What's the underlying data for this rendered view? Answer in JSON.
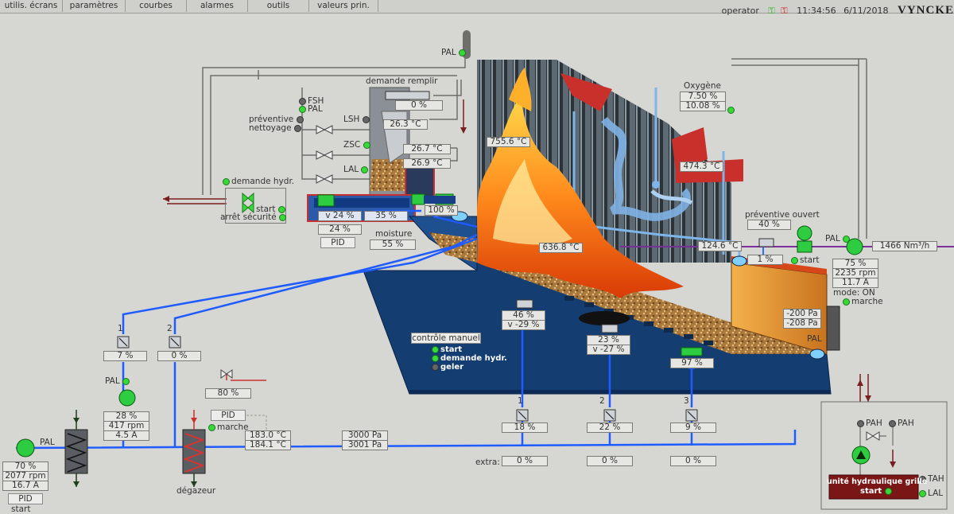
{
  "menu": {
    "tabs": [
      "utilis. écrans",
      "paramètres",
      "courbes",
      "alarmes",
      "outils",
      "valeurs prin."
    ]
  },
  "status": {
    "user": "operator",
    "time": "11:34:56",
    "date": "6/11/2018",
    "brand": "VYNCKE"
  },
  "top_labels": {
    "pal_top": "PAL",
    "demande_remplir": "demande remplir",
    "pct_remplir": "0 %",
    "fsh": "FSH",
    "pal_left": "PAL",
    "preventive": "préventive",
    "nettoyage": "nettoyage",
    "lsh": "LSH",
    "zsc": "ZSC",
    "lal": "LAL",
    "t1": "26.3 °C",
    "t2": "26.7 °C",
    "t3": "26.9 °C"
  },
  "feeder": {
    "demande_hydr": "demande hydr.",
    "start": "start",
    "arret": "arrêt sécurité",
    "v": "v 24 %",
    "pct": "35 %",
    "pct2": "24 %",
    "pct3": "100 %",
    "pid": "PID",
    "moisture_label": "moisture",
    "moisture": "55 %"
  },
  "furnace": {
    "t_flame": "755.6 °C",
    "t_bed": "636.8 °C",
    "t_tube": "474.3 °C",
    "oxy_label": "Oxygène",
    "oxy1": "7.50 %",
    "oxy2": "10.08 %",
    "ctrl": "contrôle manuel",
    "ctrl_start": "start",
    "ctrl_dem": "demande hydr.",
    "ctrl_geler": "geler",
    "g1a": "46 %",
    "g1b": "v -29 %",
    "g2a": "23 %",
    "g2b": "v -27 %",
    "g3a": "97 %"
  },
  "right": {
    "prev_ouvert": "préventive ouvert",
    "prev_pct": "40 %",
    "t_out": "124.6 °C",
    "pct_1": "1 %",
    "start": "start",
    "pal": "PAL",
    "flow": "1466 Nm³/h",
    "fan1": "75 %",
    "fan2": "2235 rpm",
    "fan3": "11.7 A",
    "mode": "mode: ON",
    "marche": "marche",
    "p1": "-200 Pa",
    "p2": "-208 Pa",
    "pal2": "PAL"
  },
  "hydraulic": {
    "pah1": "PAH",
    "pah2": "PAH",
    "tah": "TAH",
    "lal": "LAL",
    "unit": "unité hydraulique grille",
    "start": "start"
  },
  "bottom": {
    "v1": "1",
    "v2": "2",
    "v1pct": "7 %",
    "v2pct": "0 %",
    "pal": "PAL",
    "pump1": "28 %",
    "pump2": "417 rpm",
    "pump3": "4.5 A",
    "valve80": "80 %",
    "pid": "PID",
    "marche": "marche",
    "tin": "183.0 °C",
    "tout": "184.1 °C",
    "p1": "3000 Pa",
    "p2": "3001 Pa",
    "degazeur": "dégazeur",
    "z1": "1",
    "z2": "2",
    "z3": "3",
    "z1pct": "18 %",
    "z2pct": "22 %",
    "z3pct": "9 %",
    "extra": "extra:",
    "e1": "0 %",
    "e2": "0 %",
    "e3": "0 %",
    "mp1": "70 %",
    "mp2": "2077 rpm",
    "mp3": "16.7 A",
    "pal_main": "PAL",
    "pid2": "PID",
    "start": "start"
  }
}
